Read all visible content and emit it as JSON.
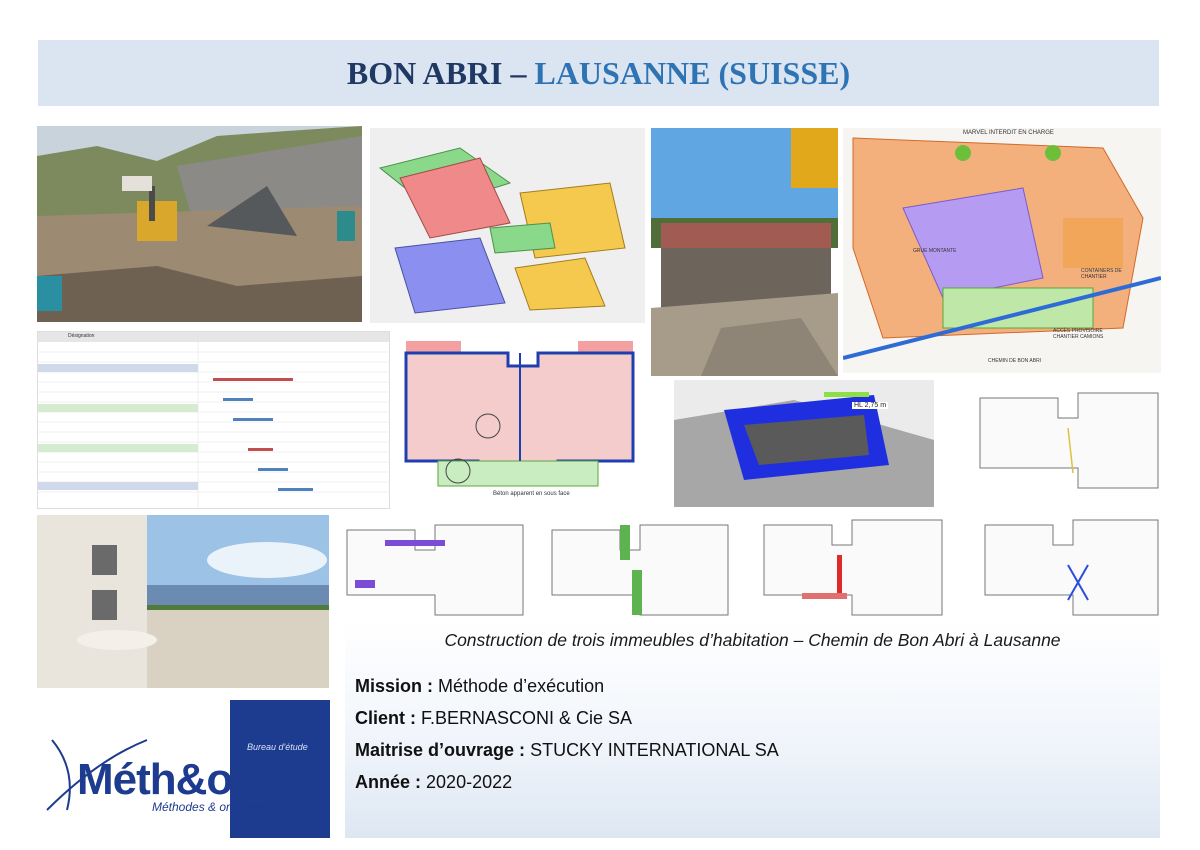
{
  "title": {
    "part1": "BON ABRI",
    "separator": "–",
    "part2": "LAUSANNE (SUISSE)"
  },
  "figures": {
    "gantt_header": "Désignation",
    "plan_labels": {
      "center": "Béton apparent en sous face",
      "height_tag": "HL 2,75 m"
    },
    "site_plan_labels": {
      "top": "MARVEL INTERDIT EN CHARGE",
      "lbl1": "CONTAINERS DE CHANTIER",
      "lbl2": "GRUE MONTANTE",
      "lbl3": "ACCÈS PROVISOIRE CHANTIER CAMIONS",
      "lbl4": "CHEMIN DE BON ABRI"
    }
  },
  "caption": "Construction de trois immeubles d’habitation – Chemin de Bon Abri à Lausanne",
  "info": [
    {
      "label": "Mission :",
      "value": "Méthode d’exécution"
    },
    {
      "label": "Client :",
      "value": "F.BERNASCONI & Cie SA"
    },
    {
      "label": "Maitrise d’ouvrage :",
      "value": "STUCKY INTERNATIONAL SA"
    },
    {
      "label": "Année :",
      "value": "2020-2022"
    }
  ],
  "logo": {
    "name": "Méth&or",
    "tagline": "Méthodes & organisation",
    "bureau": "Bureau d'étude"
  },
  "colors": {
    "banner_bg": "#dbe5f1",
    "title_dark": "#1f3864",
    "title_blue": "#2e74b5",
    "logo_blue": "#1d3b8f"
  }
}
